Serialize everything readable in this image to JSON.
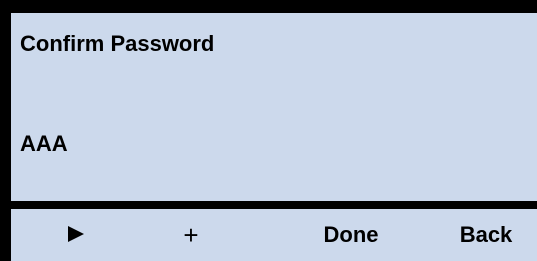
{
  "screen": {
    "title": "Confirm Password",
    "value": "AAA"
  },
  "softkeys": {
    "play_icon": "play-icon",
    "plus_label": "+",
    "done_label": "Done",
    "back_label": "Back"
  },
  "colors": {
    "background": "#ccd9ec",
    "border": "#000000",
    "text": "#000000"
  }
}
